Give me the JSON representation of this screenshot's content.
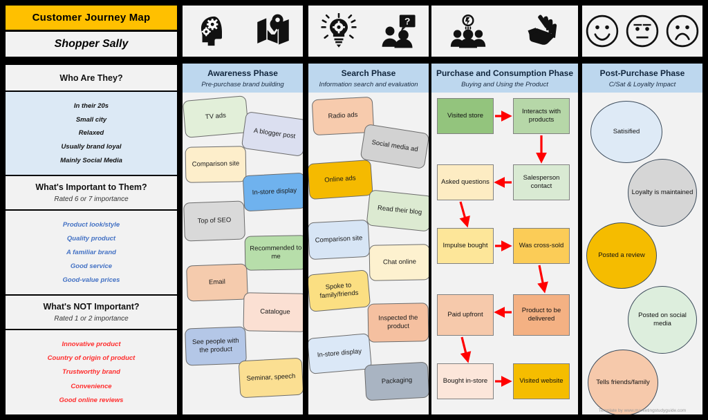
{
  "header": {
    "title": "Customer Journey Map",
    "persona": "Shopper Sally",
    "icons": [
      {
        "name": "head-gears-icon"
      },
      {
        "name": "map-pin-icon"
      },
      {
        "name": "lightbulb-gear-icon"
      },
      {
        "name": "people-question-icon"
      },
      {
        "name": "group-idea-icon"
      },
      {
        "name": "hand-reach-icon"
      },
      {
        "name": "happy-face-icon"
      },
      {
        "name": "neutral-face-icon"
      },
      {
        "name": "sad-face-icon"
      }
    ]
  },
  "sidebar": {
    "who": {
      "heading": "Who Are They?",
      "subheading": "",
      "items": [
        "In their 20s",
        "Small city",
        "Relaxed",
        "Usually brand loyal",
        "Mainly Social Media"
      ]
    },
    "important": {
      "heading": "What's Important to Them?",
      "subheading": "Rated 6 or 7 importance",
      "items": [
        "Product look/style",
        "Quality product",
        "A familiar brand",
        "Good service",
        "Good-value prices"
      ]
    },
    "not_important": {
      "heading": "What's NOT Important?",
      "subheading": "Rated 1 or 2 importance",
      "items": [
        "Innovative product",
        "Country of origin of product",
        "Trustworthy brand",
        "Convenience",
        "Good online reviews"
      ]
    }
  },
  "columns": [
    {
      "id": "awareness",
      "title": "Awareness Phase",
      "subtitle": "Pre-purchase brand building",
      "notes": [
        {
          "label": "TV ads",
          "color": "#e2efd9"
        },
        {
          "label": "A blogger post",
          "color": "#dbdff0"
        },
        {
          "label": "Comparison site",
          "color": "#fdeecb"
        },
        {
          "label": "In-store display",
          "color": "#6fb2ee"
        },
        {
          "label": "Top of SEO",
          "color": "#d9d9d9"
        },
        {
          "label": "Recommended to me",
          "color": "#b7deaa"
        },
        {
          "label": "Email",
          "color": "#f5cbad"
        },
        {
          "label": "Catalogue",
          "color": "#fbe0d3"
        },
        {
          "label": "See people with the product",
          "color": "#b4c7e7"
        },
        {
          "label": "Seminar, speech",
          "color": "#fbdf92"
        }
      ]
    },
    {
      "id": "search",
      "title": "Search Phase",
      "subtitle": "Information search and evaluation",
      "notes": [
        {
          "label": "Radio ads",
          "color": "#f7cbad"
        },
        {
          "label": "Social media ad",
          "color": "#d2d2d2"
        },
        {
          "label": "Online ads",
          "color": "#f5ba00"
        },
        {
          "label": "Read their blog",
          "color": "#dcead1"
        },
        {
          "label": "Comparison site",
          "color": "#d7e5f5"
        },
        {
          "label": "Chat online",
          "color": "#fdf1cf"
        },
        {
          "label": "Spoke to family/friends",
          "color": "#fbdf82"
        },
        {
          "label": "Inspected the product",
          "color": "#f5c0a0"
        },
        {
          "label": "In-store display",
          "color": "#dbe8f7"
        },
        {
          "label": "Packaging",
          "color": "#a9b4c2"
        }
      ]
    },
    {
      "id": "purchase",
      "title": "Purchase and Consumption Phase",
      "subtitle": "Buying and Using the Product",
      "boxes": [
        {
          "label": "Visited store",
          "color": "#93c47d"
        },
        {
          "label": "Interacts with products",
          "color": "#b6d7a8"
        },
        {
          "label": "Asked questions",
          "color": "#fdecc3"
        },
        {
          "label": "Salesperson contact",
          "color": "#d9ead3"
        },
        {
          "label": "Impulse bought",
          "color": "#fde699"
        },
        {
          "label": "Was cross-sold",
          "color": "#fbcc57"
        },
        {
          "label": "Paid upfront",
          "color": "#f6c9ab"
        },
        {
          "label": "Product  to be delivered",
          "color": "#f4b183"
        },
        {
          "label": "Bought in-store",
          "color": "#fce6da"
        },
        {
          "label": "Visited website",
          "color": "#f5bd00"
        }
      ],
      "arrow_color": "#ff0000"
    },
    {
      "id": "post",
      "title": "Post-Purchase Phase",
      "subtitle": "C/Sat & Loyalty Impact",
      "circles": [
        {
          "label": "Satisified",
          "color": "#deeaf6"
        },
        {
          "label": "Loyalty is maintained",
          "color": "#d6d6d6"
        },
        {
          "label": "Posted a review",
          "color": "#f5bc00"
        },
        {
          "label": "Posted on social media",
          "color": "#ddeedd"
        },
        {
          "label": "Tells friends/family",
          "color": "#f6c9ab"
        }
      ]
    }
  ],
  "footer": "Template by www.marketingstudyguide.com",
  "colors": {
    "accent": "#FFC000",
    "header_blue": "#bdd7ee",
    "panel": "#f2f2f2",
    "arrow_red": "#ff0000"
  }
}
